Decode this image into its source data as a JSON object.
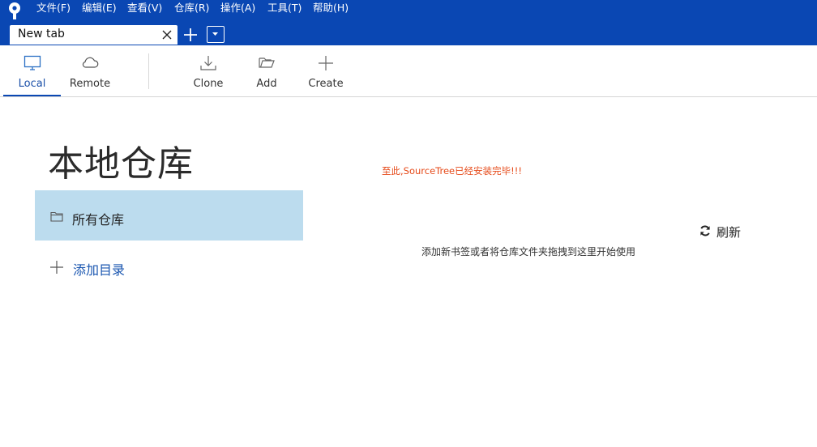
{
  "menubar": {
    "items": [
      "文件(F)",
      "编辑(E)",
      "查看(V)",
      "仓库(R)",
      "操作(A)",
      "工具(T)",
      "帮助(H)"
    ]
  },
  "tabs": {
    "active_title": "New tab"
  },
  "toolbar": {
    "local_label": "Local",
    "remote_label": "Remote",
    "clone_label": "Clone",
    "add_label": "Add",
    "create_label": "Create"
  },
  "main": {
    "title": "本地仓库",
    "sidebar": {
      "all_repos_label": "所有仓库",
      "add_directory_label": "添加目录"
    },
    "annotation": "至此,SourceTree已经安装完毕!!!",
    "refresh_label": "刷新",
    "hint": "添加新书签或者将仓库文件夹拖拽到这里开始使用"
  },
  "colors": {
    "chrome_blue": "#0a47b3",
    "selection": "#bcdcee",
    "link_blue": "#1a56b0",
    "annotation_red": "#e64a19"
  },
  "icons": {
    "app": "sourcetree-logo-icon",
    "tab_close": "close-icon",
    "new_tab": "plus-icon",
    "tab_menu": "chevron-down-icon",
    "local": "monitor-icon",
    "remote": "cloud-icon",
    "clone": "download-icon",
    "add": "folder-open-icon",
    "create": "plus-icon",
    "all_repos": "folder-icon",
    "add_directory": "plus-icon",
    "refresh": "refresh-icon"
  }
}
